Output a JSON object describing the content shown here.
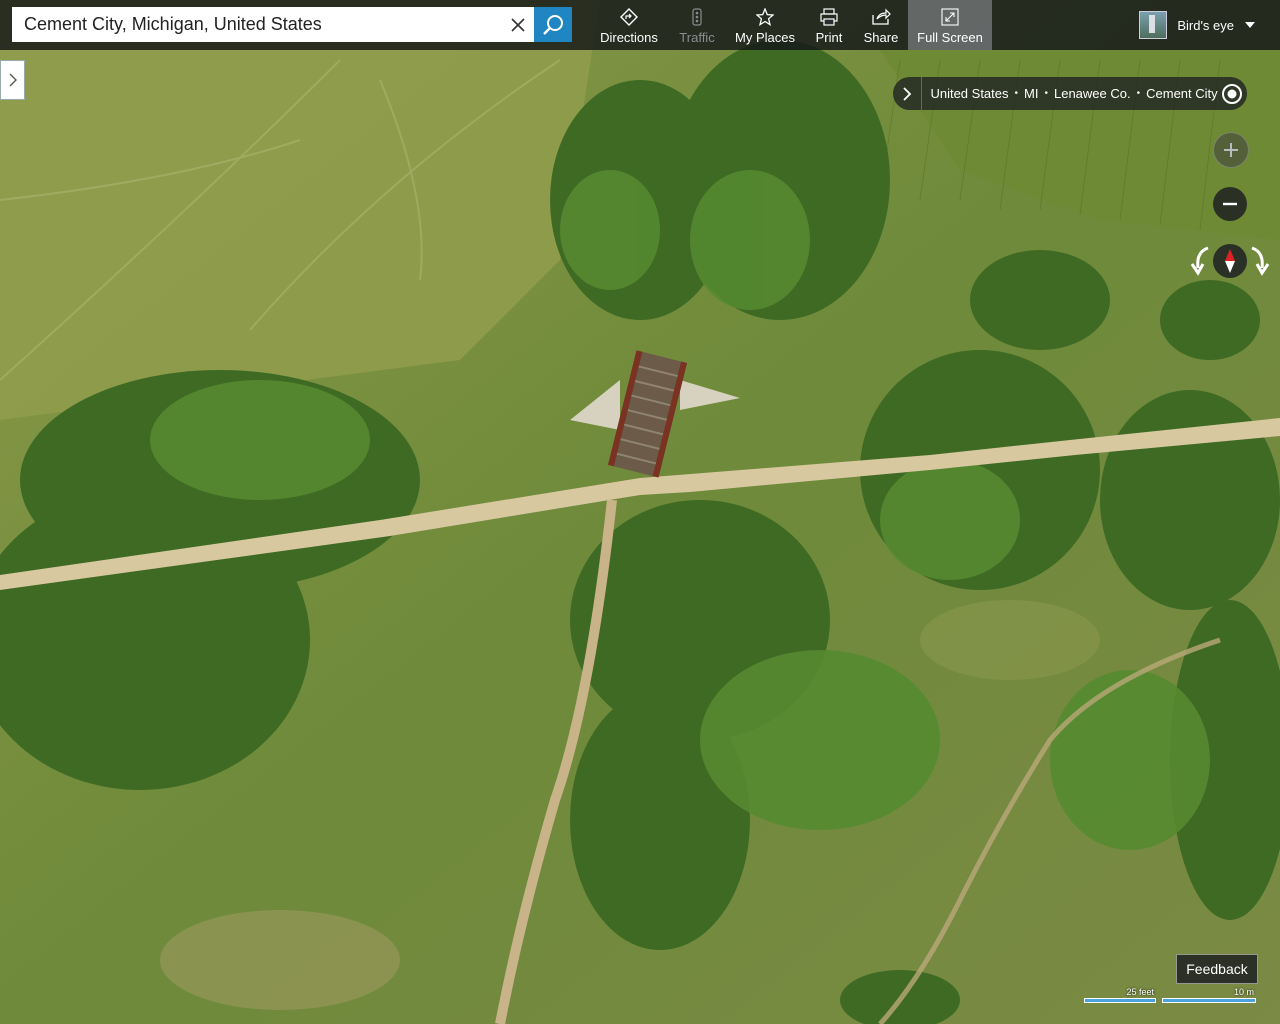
{
  "search": {
    "value": "Cement City, Michigan, United States",
    "placeholder": ""
  },
  "toolbar": {
    "directions": "Directions",
    "traffic": "Traffic",
    "my_places": "My Places",
    "print": "Print",
    "share": "Share",
    "full_screen": "Full Screen"
  },
  "view": {
    "label": "Bird's eye"
  },
  "breadcrumb": [
    "United States",
    "MI",
    "Lenawee Co.",
    "Cement City"
  ],
  "feedback": "Feedback",
  "scale": {
    "imperial": "25 feet",
    "metric": "10 m"
  },
  "colors": {
    "accent": "#1f86c2",
    "compass_red": "#d22",
    "scale_bar": "#4aa3df"
  }
}
